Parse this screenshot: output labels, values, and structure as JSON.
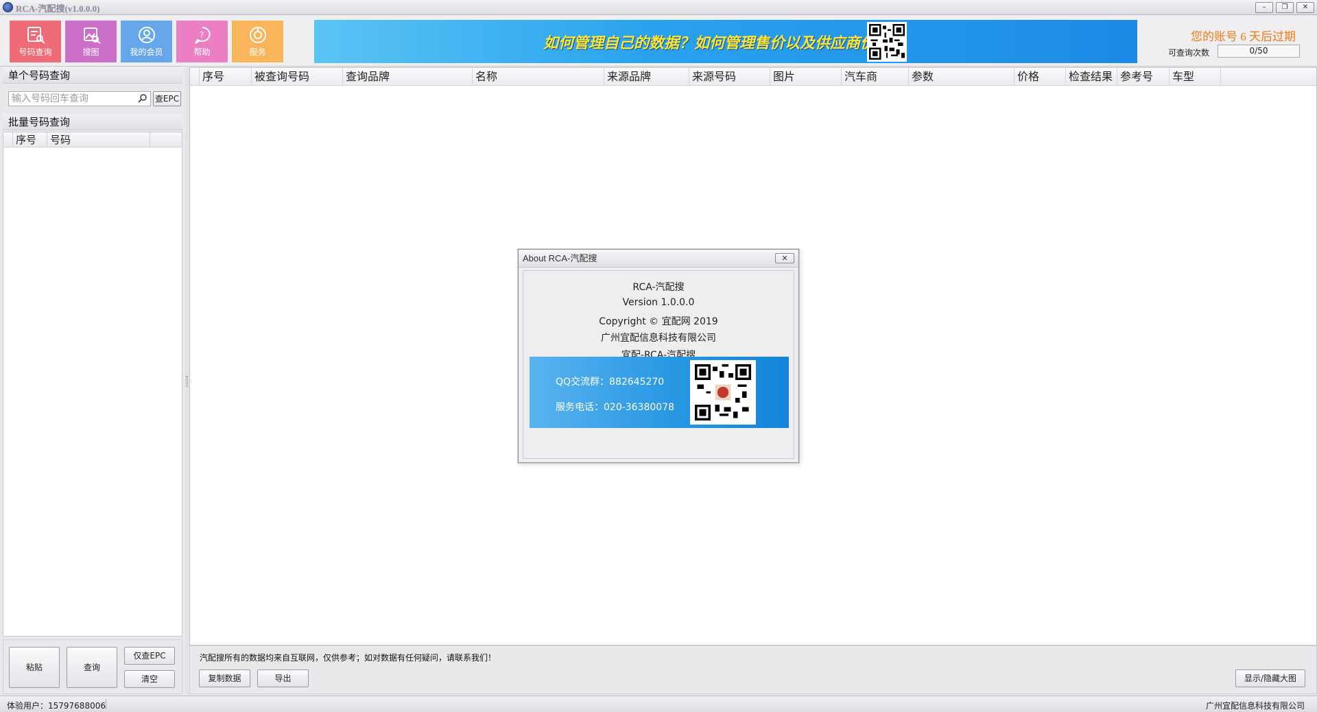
{
  "window": {
    "title": "RCA-汽配搜(v1.0.0.0)",
    "minimize": "–",
    "restore": "❐",
    "close": "✕"
  },
  "toolbar": {
    "buttons": [
      {
        "label": "号码查询",
        "color": "#f06b78",
        "icon": "search-doc-icon"
      },
      {
        "label": "搜图",
        "color": "#cc6fc8",
        "icon": "image-search-icon"
      },
      {
        "label": "我的会员",
        "color": "#66a6ea",
        "icon": "member-icon"
      },
      {
        "label": "帮助",
        "color": "#ec7fc3",
        "icon": "help-icon"
      },
      {
        "label": "服务",
        "color": "#f9b55a",
        "icon": "service-icon"
      }
    ],
    "banner_text": "如何管理自己的数据？如何管理售价以及供应商价格？",
    "expire_text": "您的账号 6 天后过期",
    "quota_label": "可查询次数",
    "quota_value": "0/50"
  },
  "left": {
    "single_title": "单个号码查询",
    "search_placeholder": "输入号码回车查询",
    "epc_button": "查EPC",
    "batch_title": "批量号码查询",
    "batch_columns": [
      "序号",
      "号码"
    ],
    "buttons": {
      "paste": "粘贴",
      "query": "查询",
      "epc_only": "仅查EPC",
      "clear": "清空"
    }
  },
  "grid": {
    "columns": [
      "序号",
      "被查询号码",
      "查询品牌",
      "名称",
      "来源品牌",
      "来源号码",
      "图片",
      "汽车商",
      "参数",
      "价格",
      "检查结果",
      "参考号",
      "车型"
    ]
  },
  "footer": {
    "disclaimer": "汽配搜所有的数据均来自互联网，仅供参考；如对数据有任何疑问，请联系我们！",
    "copy_button": "复制数据",
    "export_button": "导出",
    "toggle_button": "显示/隐藏大图"
  },
  "status": {
    "user": "体验用户：15797688006",
    "company": "广州宜配信息科技有限公司"
  },
  "about_dialog": {
    "title": "About RCA-汽配搜",
    "close": "✕",
    "lines": [
      "RCA-汽配搜",
      "Version 1.0.0.0",
      "Copyright © 宜配网 2019",
      "广州宜配信息科技有限公司",
      "宜配-RCA-汽配搜"
    ],
    "qq_group": "QQ交流群：882645270",
    "service_phone": "服务电话：020-36380078"
  }
}
